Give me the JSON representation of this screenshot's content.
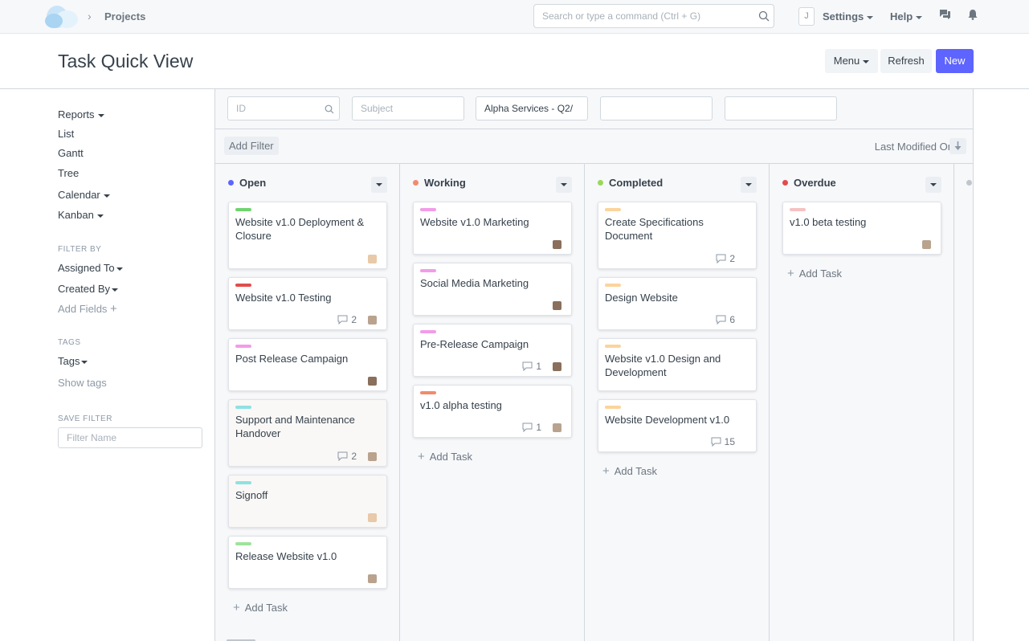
{
  "navbar": {
    "breadcrumb": "Projects",
    "search_placeholder": "Search or type a command (Ctrl + G)",
    "user_initial": "J",
    "settings_label": "Settings",
    "help_label": "Help"
  },
  "page": {
    "title": "Task Quick View",
    "menu_label": "Menu",
    "refresh_label": "Refresh",
    "new_label": "New"
  },
  "sidebar": {
    "views": [
      "Reports",
      "List",
      "Gantt",
      "Tree",
      "Calendar",
      "Kanban"
    ],
    "filter_by_heading": "FILTER BY",
    "assigned_to": "Assigned To",
    "created_by": "Created By",
    "add_fields": "Add Fields",
    "tags_heading": "TAGS",
    "tags": "Tags",
    "show_tags": "Show tags",
    "save_filter_heading": "SAVE FILTER",
    "filter_name_placeholder": "Filter Name"
  },
  "filters": {
    "id_placeholder": "ID",
    "subject_placeholder": "Subject",
    "project_value": "Alpha Services - Q2/",
    "add_filter_label": "Add Filter",
    "sort_label": "Last Modified On"
  },
  "kanban": {
    "add_task_label": "Add Task",
    "columns": [
      {
        "name": "Open",
        "dot_color": "#5e64ff",
        "cards": [
          {
            "title": "Website v1.0 Deployment & Closure",
            "bar_color": "#6fd46f",
            "comments": "",
            "assignee": "assignee-a"
          },
          {
            "title": "Website v1.0 Testing",
            "bar_color": "#e24c4c",
            "comments": "2",
            "assignee": "assignee-b"
          },
          {
            "title": "Post Release Campaign",
            "bar_color": "#f29ce8",
            "comments": "",
            "assignee": "assignee-c"
          },
          {
            "title": "Support and Maintenance Handover",
            "bar_color": "#8ee1e3",
            "comments": "2",
            "assignee": "assignee-b"
          },
          {
            "title": "Signoff",
            "bar_color": "#8ee1e3",
            "comments": "",
            "assignee": "assignee-a"
          },
          {
            "title": "Release Website v1.0",
            "bar_color": "#9fe39a",
            "comments": "",
            "assignee": "assignee-b"
          }
        ]
      },
      {
        "name": "Working",
        "dot_color": "#f28b6c",
        "cards": [
          {
            "title": "Website v1.0 Marketing",
            "bar_color": "#f29ce8",
            "comments": "",
            "assignee": "assignee-c"
          },
          {
            "title": "Social Media Marketing",
            "bar_color": "#f29ce8",
            "comments": "",
            "assignee": "assignee-c"
          },
          {
            "title": "Pre-Release Campaign",
            "bar_color": "#f29ce8",
            "comments": "1",
            "assignee": "assignee-c"
          },
          {
            "title": "v1.0 alpha testing",
            "bar_color": "#f28b6c",
            "comments": "1",
            "assignee": "assignee-b"
          }
        ]
      },
      {
        "name": "Completed",
        "dot_color": "#98d85b",
        "cards": [
          {
            "title": "Create Specifications Document",
            "bar_color": "#fbd49c",
            "comments": "2",
            "assignee": ""
          },
          {
            "title": "Design Website",
            "bar_color": "#fbd49c",
            "comments": "6",
            "assignee": ""
          },
          {
            "title": "Website v1.0 Design and Development",
            "bar_color": "#fbd49c",
            "comments": "",
            "assignee": ""
          },
          {
            "title": "Website Development v1.0",
            "bar_color": "#fbd49c",
            "comments": "15",
            "assignee": ""
          }
        ]
      },
      {
        "name": "Overdue",
        "dot_color": "#e24c4c",
        "cards": [
          {
            "title": "v1.0 beta testing",
            "bar_color": "#f5c2c2",
            "comments": "",
            "assignee": "assignee-b"
          }
        ]
      }
    ]
  }
}
